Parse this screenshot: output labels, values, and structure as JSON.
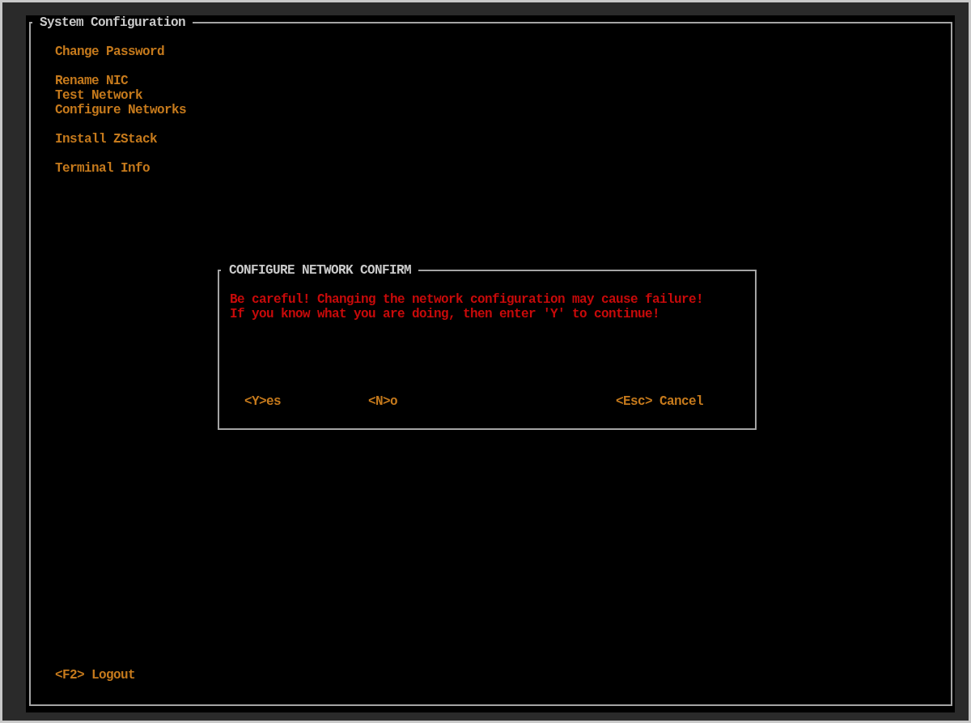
{
  "window": {
    "title": "System Configuration"
  },
  "menu": {
    "groups": [
      {
        "items": [
          "Change Password"
        ]
      },
      {
        "items": [
          "Rename NIC",
          "Test Network",
          "Configure Networks"
        ]
      },
      {
        "items": [
          "Install ZStack"
        ]
      },
      {
        "items": [
          "Terminal Info"
        ]
      }
    ]
  },
  "dialog": {
    "title": "CONFIGURE NETWORK CONFIRM",
    "message_lines": [
      "Be careful! Changing the network configuration may cause failure!",
      "If you know what you are doing, then enter 'Y' to continue!"
    ],
    "buttons": [
      "<Y>es",
      "<N>o",
      "<Esc> Cancel"
    ]
  },
  "footer": {
    "shortcut": "<F2> Logout"
  }
}
